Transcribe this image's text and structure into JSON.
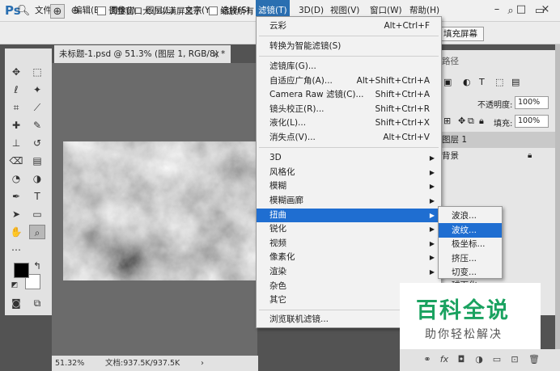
{
  "app": {
    "logo": "Ps",
    "menus": [
      "文件(F)",
      "编辑(E)",
      "图像(I)",
      "图层(L)",
      "文字(Y)",
      "选择(S)",
      "滤镜(T)",
      "3D(D)",
      "视图(V)",
      "窗口(W)",
      "帮助(H)"
    ],
    "window_controls": [
      "minimize-icon",
      "maximize-icon",
      "close-icon"
    ]
  },
  "options_bar": {
    "resize_label": "调整窗口大小以满屏显示",
    "zoom_all_label": "缩放所有",
    "fill_screen_label": "填充屏幕"
  },
  "document": {
    "tab_title": "未标题-1.psd @ 51.3% (图层 1, RGB/8) *",
    "tab_close": "×",
    "zoom": "51.32%",
    "doc_size": "文档:937.5K/937.5K",
    "status_arrow": "›"
  },
  "filter_menu": {
    "items": [
      {
        "label": "云彩",
        "shortcut": "Alt+Ctrl+F"
      },
      {
        "label": "转换为智能滤镜(S)",
        "shortcut": ""
      },
      {
        "label": "滤镜库(G)...",
        "shortcut": ""
      },
      {
        "label": "自适应广角(A)...",
        "shortcut": "Alt+Shift+Ctrl+A"
      },
      {
        "label": "Camera Raw 滤镜(C)...",
        "shortcut": "Shift+Ctrl+A"
      },
      {
        "label": "镜头校正(R)...",
        "shortcut": "Shift+Ctrl+R"
      },
      {
        "label": "液化(L)...",
        "shortcut": "Shift+Ctrl+X"
      },
      {
        "label": "消失点(V)...",
        "shortcut": "Alt+Ctrl+V"
      },
      {
        "label": "3D",
        "shortcut": ""
      },
      {
        "label": "风格化",
        "shortcut": ""
      },
      {
        "label": "模糊",
        "shortcut": ""
      },
      {
        "label": "模糊画廊",
        "shortcut": ""
      },
      {
        "label": "扭曲",
        "shortcut": ""
      },
      {
        "label": "锐化",
        "shortcut": ""
      },
      {
        "label": "视频",
        "shortcut": ""
      },
      {
        "label": "像素化",
        "shortcut": ""
      },
      {
        "label": "渲染",
        "shortcut": ""
      },
      {
        "label": "杂色",
        "shortcut": ""
      },
      {
        "label": "其它",
        "shortcut": ""
      },
      {
        "label": "浏览联机滤镜...",
        "shortcut": ""
      }
    ],
    "submenu_arrow": "▶"
  },
  "distort_submenu": {
    "items": [
      "波浪...",
      "波纹...",
      "极坐标...",
      "挤压...",
      "切变...",
      "球面化..."
    ]
  },
  "right_panel": {
    "paths_tab": "路径",
    "opacity_label": "不透明度:",
    "opacity_value": "100%",
    "fill_label": "填充:",
    "fill_value": "100%",
    "layers": [
      "图层 1",
      "背景"
    ]
  },
  "watermark": {
    "logo": "百科全说",
    "subtitle": "助你轻松解决"
  },
  "colors": {
    "menu_highlight": "#1f6ed1",
    "ps_blue": "#2a6fb1",
    "watermark_green": "#1aa260",
    "foreground": "#000000",
    "background": "#ffffff"
  }
}
